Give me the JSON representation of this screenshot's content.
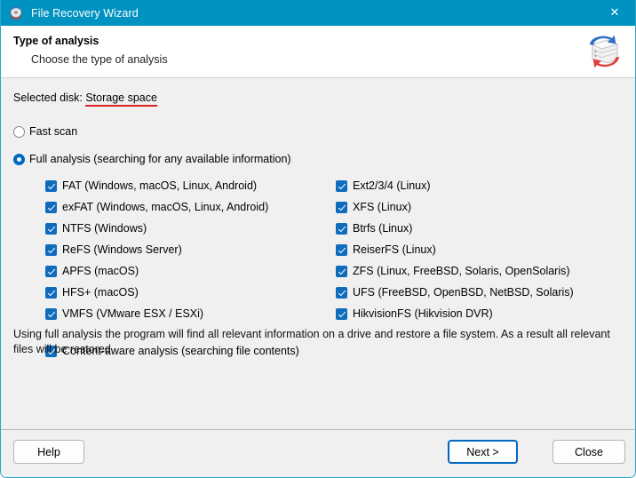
{
  "window": {
    "title": "File Recovery Wizard",
    "icon": "disk-recovery-icon",
    "close_label": "✕",
    "accent_color": "#0092c0"
  },
  "header": {
    "title": "Type of analysis",
    "subtitle": "Choose the type of analysis",
    "logo": "disk-stack-recovery-logo"
  },
  "selected_disk": {
    "label": "Selected disk:",
    "value": "Storage space",
    "underline_color": "#e02020"
  },
  "scan_modes": [
    {
      "id": "fast",
      "label": "Fast scan",
      "checked": false
    },
    {
      "id": "full",
      "label": "Full analysis (searching for any available information)",
      "checked": true
    }
  ],
  "filesystems": {
    "left": [
      {
        "label": "FAT (Windows, macOS, Linux, Android)",
        "checked": true
      },
      {
        "label": "exFAT (Windows, macOS, Linux, Android)",
        "checked": true
      },
      {
        "label": "NTFS (Windows)",
        "checked": true
      },
      {
        "label": "ReFS (Windows Server)",
        "checked": true
      },
      {
        "label": "APFS (macOS)",
        "checked": true
      },
      {
        "label": "HFS+ (macOS)",
        "checked": true
      },
      {
        "label": "VMFS (VMware ESX / ESXi)",
        "checked": true
      }
    ],
    "right": [
      {
        "label": "Ext2/3/4 (Linux)",
        "checked": true
      },
      {
        "label": "XFS (Linux)",
        "checked": true
      },
      {
        "label": "Btrfs (Linux)",
        "checked": true
      },
      {
        "label": "ReiserFS (Linux)",
        "checked": true
      },
      {
        "label": "ZFS (Linux, FreeBSD, Solaris, OpenSolaris)",
        "checked": true
      },
      {
        "label": "UFS (FreeBSD, OpenBSD, NetBSD, Solaris)",
        "checked": true
      },
      {
        "label": "HikvisionFS (Hikvision DVR)",
        "checked": true
      }
    ]
  },
  "content_aware": {
    "label": "Content-aware analysis (searching file contents)",
    "checked": true
  },
  "note": "Using full analysis the program will find all relevant information on a drive and restore a file system. As a result all relevant files will be restored.",
  "footer": {
    "help_label": "Help",
    "next_label": "Next >",
    "close_label": "Close",
    "default_button_color": "#0067c0"
  }
}
